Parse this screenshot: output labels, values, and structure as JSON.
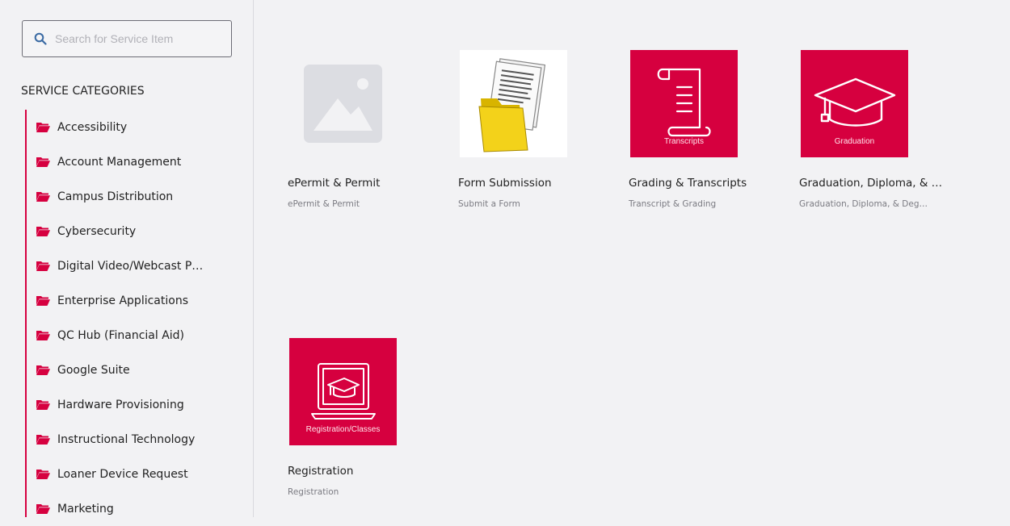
{
  "search": {
    "placeholder": "Search for Service Item"
  },
  "categories_heading": "SERVICE CATEGORIES",
  "categories": [
    "Accessibility",
    "Account Management",
    "Campus Distribution",
    "Cybersecurity",
    "Digital Video/Webcast P…",
    "Enterprise Applications",
    "QC Hub (Financial Aid)",
    "Google Suite",
    "Hardware Provisioning",
    "Instructional Technology",
    "Loaner Device Request",
    "Marketing"
  ],
  "tiles": [
    {
      "title": "ePermit & Permit",
      "subtitle": "ePermit & Permit",
      "image": "placeholder-image-icon"
    },
    {
      "title": "Form Submission",
      "subtitle": "Submit a Form",
      "image": "document-folder-icon"
    },
    {
      "title": "Grading & Transcripts",
      "subtitle": "Transcript & Grading",
      "image": "scroll-icon",
      "caption": "Transcripts"
    },
    {
      "title": "Graduation, Diploma, & …",
      "subtitle": "Graduation, Diploma, & Deg…",
      "image": "graduation-cap-icon",
      "caption": "Graduation"
    },
    {
      "title": "Registration",
      "subtitle": "Registration",
      "image": "laptop-cap-icon",
      "caption": "Registration/Classes"
    }
  ],
  "colors": {
    "accent": "#d6003f",
    "background": "#f2f2f4",
    "folder": "#d6003f"
  }
}
